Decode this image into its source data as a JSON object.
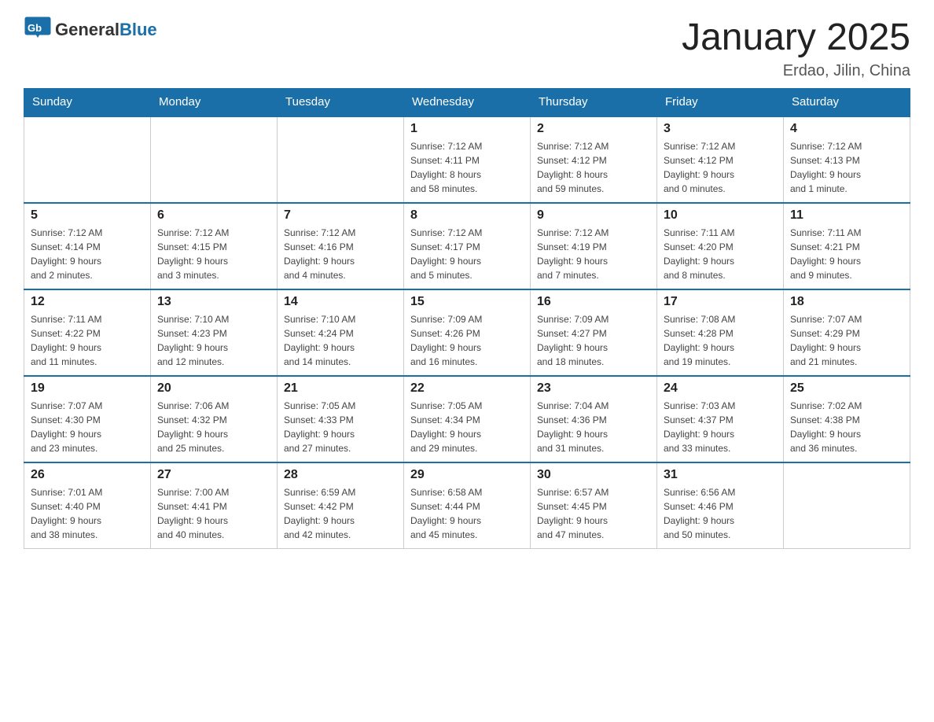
{
  "header": {
    "logo_general": "General",
    "logo_blue": "Blue",
    "title": "January 2025",
    "subtitle": "Erdao, Jilin, China"
  },
  "days_of_week": [
    "Sunday",
    "Monday",
    "Tuesday",
    "Wednesday",
    "Thursday",
    "Friday",
    "Saturday"
  ],
  "weeks": [
    [
      {
        "day": "",
        "info": ""
      },
      {
        "day": "",
        "info": ""
      },
      {
        "day": "",
        "info": ""
      },
      {
        "day": "1",
        "info": "Sunrise: 7:12 AM\nSunset: 4:11 PM\nDaylight: 8 hours\nand 58 minutes."
      },
      {
        "day": "2",
        "info": "Sunrise: 7:12 AM\nSunset: 4:12 PM\nDaylight: 8 hours\nand 59 minutes."
      },
      {
        "day": "3",
        "info": "Sunrise: 7:12 AM\nSunset: 4:12 PM\nDaylight: 9 hours\nand 0 minutes."
      },
      {
        "day": "4",
        "info": "Sunrise: 7:12 AM\nSunset: 4:13 PM\nDaylight: 9 hours\nand 1 minute."
      }
    ],
    [
      {
        "day": "5",
        "info": "Sunrise: 7:12 AM\nSunset: 4:14 PM\nDaylight: 9 hours\nand 2 minutes."
      },
      {
        "day": "6",
        "info": "Sunrise: 7:12 AM\nSunset: 4:15 PM\nDaylight: 9 hours\nand 3 minutes."
      },
      {
        "day": "7",
        "info": "Sunrise: 7:12 AM\nSunset: 4:16 PM\nDaylight: 9 hours\nand 4 minutes."
      },
      {
        "day": "8",
        "info": "Sunrise: 7:12 AM\nSunset: 4:17 PM\nDaylight: 9 hours\nand 5 minutes."
      },
      {
        "day": "9",
        "info": "Sunrise: 7:12 AM\nSunset: 4:19 PM\nDaylight: 9 hours\nand 7 minutes."
      },
      {
        "day": "10",
        "info": "Sunrise: 7:11 AM\nSunset: 4:20 PM\nDaylight: 9 hours\nand 8 minutes."
      },
      {
        "day": "11",
        "info": "Sunrise: 7:11 AM\nSunset: 4:21 PM\nDaylight: 9 hours\nand 9 minutes."
      }
    ],
    [
      {
        "day": "12",
        "info": "Sunrise: 7:11 AM\nSunset: 4:22 PM\nDaylight: 9 hours\nand 11 minutes."
      },
      {
        "day": "13",
        "info": "Sunrise: 7:10 AM\nSunset: 4:23 PM\nDaylight: 9 hours\nand 12 minutes."
      },
      {
        "day": "14",
        "info": "Sunrise: 7:10 AM\nSunset: 4:24 PM\nDaylight: 9 hours\nand 14 minutes."
      },
      {
        "day": "15",
        "info": "Sunrise: 7:09 AM\nSunset: 4:26 PM\nDaylight: 9 hours\nand 16 minutes."
      },
      {
        "day": "16",
        "info": "Sunrise: 7:09 AM\nSunset: 4:27 PM\nDaylight: 9 hours\nand 18 minutes."
      },
      {
        "day": "17",
        "info": "Sunrise: 7:08 AM\nSunset: 4:28 PM\nDaylight: 9 hours\nand 19 minutes."
      },
      {
        "day": "18",
        "info": "Sunrise: 7:07 AM\nSunset: 4:29 PM\nDaylight: 9 hours\nand 21 minutes."
      }
    ],
    [
      {
        "day": "19",
        "info": "Sunrise: 7:07 AM\nSunset: 4:30 PM\nDaylight: 9 hours\nand 23 minutes."
      },
      {
        "day": "20",
        "info": "Sunrise: 7:06 AM\nSunset: 4:32 PM\nDaylight: 9 hours\nand 25 minutes."
      },
      {
        "day": "21",
        "info": "Sunrise: 7:05 AM\nSunset: 4:33 PM\nDaylight: 9 hours\nand 27 minutes."
      },
      {
        "day": "22",
        "info": "Sunrise: 7:05 AM\nSunset: 4:34 PM\nDaylight: 9 hours\nand 29 minutes."
      },
      {
        "day": "23",
        "info": "Sunrise: 7:04 AM\nSunset: 4:36 PM\nDaylight: 9 hours\nand 31 minutes."
      },
      {
        "day": "24",
        "info": "Sunrise: 7:03 AM\nSunset: 4:37 PM\nDaylight: 9 hours\nand 33 minutes."
      },
      {
        "day": "25",
        "info": "Sunrise: 7:02 AM\nSunset: 4:38 PM\nDaylight: 9 hours\nand 36 minutes."
      }
    ],
    [
      {
        "day": "26",
        "info": "Sunrise: 7:01 AM\nSunset: 4:40 PM\nDaylight: 9 hours\nand 38 minutes."
      },
      {
        "day": "27",
        "info": "Sunrise: 7:00 AM\nSunset: 4:41 PM\nDaylight: 9 hours\nand 40 minutes."
      },
      {
        "day": "28",
        "info": "Sunrise: 6:59 AM\nSunset: 4:42 PM\nDaylight: 9 hours\nand 42 minutes."
      },
      {
        "day": "29",
        "info": "Sunrise: 6:58 AM\nSunset: 4:44 PM\nDaylight: 9 hours\nand 45 minutes."
      },
      {
        "day": "30",
        "info": "Sunrise: 6:57 AM\nSunset: 4:45 PM\nDaylight: 9 hours\nand 47 minutes."
      },
      {
        "day": "31",
        "info": "Sunrise: 6:56 AM\nSunset: 4:46 PM\nDaylight: 9 hours\nand 50 minutes."
      },
      {
        "day": "",
        "info": ""
      }
    ]
  ]
}
